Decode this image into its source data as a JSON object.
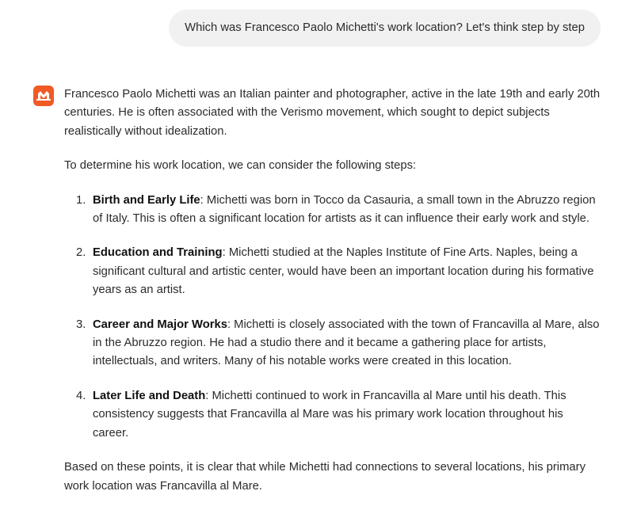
{
  "user_message": "Which was Francesco Paolo Michetti's work location? Let's think step by step",
  "assistant": {
    "avatar_icon": "m-logo-icon",
    "avatar_color": "#f05a24",
    "intro": "Francesco Paolo Michetti was an Italian painter and photographer, active in the late 19th and early 20th centuries. He is often associated with the Verismo movement, which sought to depict subjects realistically without idealization.",
    "lead": "To determine his work location, we can consider the following steps:",
    "steps": [
      {
        "number": "1.",
        "title": "Birth and Early Life",
        "text": ": Michetti was born in Tocco da Casauria, a small town in the Abruzzo region of Italy. This is often a significant location for artists as it can influence their early work and style."
      },
      {
        "number": "2.",
        "title": "Education and Training",
        "text": ": Michetti studied at the Naples Institute of Fine Arts. Naples, being a significant cultural and artistic center, would have been an important location during his formative years as an artist."
      },
      {
        "number": "3.",
        "title": "Career and Major Works",
        "text": ": Michetti is closely associated with the town of Francavilla al Mare, also in the Abruzzo region. He had a studio there and it became a gathering place for artists, intellectuals, and writers. Many of his notable works were created in this location."
      },
      {
        "number": "4.",
        "title": "Later Life and Death",
        "text": ": Michetti continued to work in Francavilla al Mare until his death. This consistency suggests that Francavilla al Mare was his primary work location throughout his career."
      }
    ],
    "conclusion": "Based on these points, it is clear that while Michetti had connections to several locations, his primary work location was Francavilla al Mare."
  }
}
